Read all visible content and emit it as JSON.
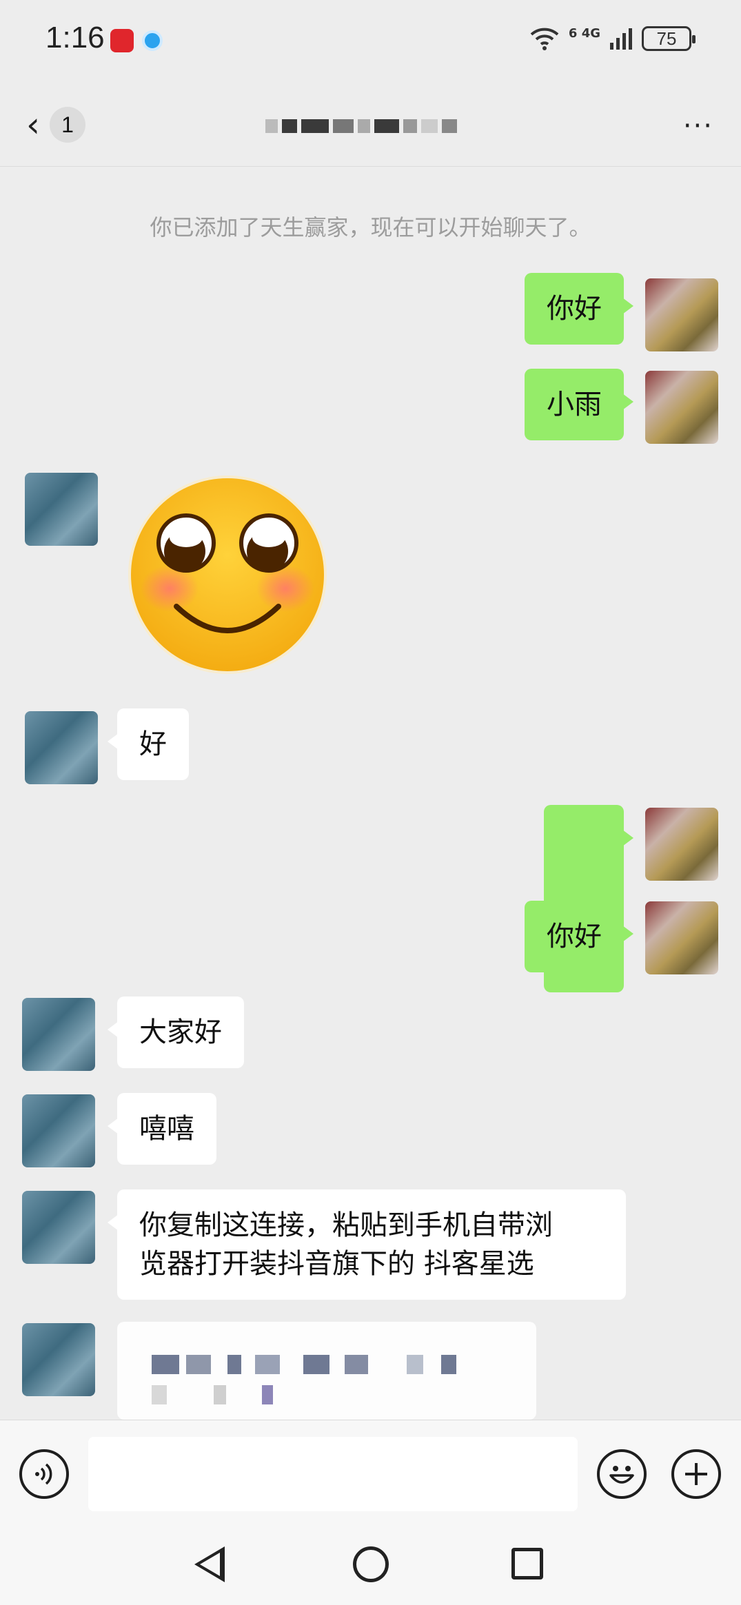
{
  "status_bar": {
    "time": "1:16",
    "signal_labels": "6 4G",
    "battery": "75"
  },
  "header": {
    "back_badge": "1",
    "more_label": "···"
  },
  "system_notice": "你已添加了天生赢家，现在可以开始聊天了。",
  "messages": [
    {
      "side": "self",
      "type": "text",
      "text": "你好"
    },
    {
      "side": "self",
      "type": "text",
      "text": "小雨"
    },
    {
      "side": "peer",
      "type": "sticker",
      "sticker": "blushing-smile-sticker"
    },
    {
      "side": "peer",
      "type": "text",
      "text": "好"
    },
    {
      "side": "self",
      "type": "emoji",
      "text": "🙂"
    },
    {
      "side": "self",
      "type": "text",
      "text": "你好"
    },
    {
      "side": "peer",
      "type": "text",
      "text": "大家好"
    },
    {
      "side": "peer",
      "type": "text",
      "text": "嘻嘻"
    },
    {
      "side": "peer",
      "type": "text",
      "text": "你复制这连接，粘贴到手机自带浏\n览器打开装抖音旗下的 抖客星选"
    },
    {
      "side": "peer",
      "type": "redacted-link"
    }
  ],
  "input_bar": {
    "voice_icon": "voice-icon",
    "emoji_icon": "smile-icon",
    "plus_icon": "plus-icon",
    "input_value": ""
  },
  "colors": {
    "background": "#ededed",
    "self_bubble": "#95ec69",
    "peer_bubble": "#ffffff",
    "system_text": "#9c9c9c"
  }
}
